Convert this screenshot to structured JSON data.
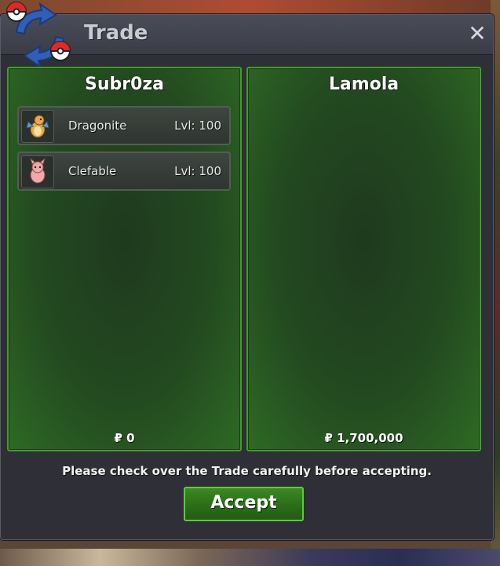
{
  "window": {
    "title": "Trade",
    "close_symbol": "✕"
  },
  "left_panel": {
    "player": "Subr0za",
    "money": "₽ 0",
    "pokemon": [
      {
        "name": "Dragonite",
        "level": "Lvl: 100",
        "icon": "dragonite-icon"
      },
      {
        "name": "Clefable",
        "level": "Lvl: 100",
        "icon": "clefable-icon"
      }
    ]
  },
  "right_panel": {
    "player": "Lamola",
    "money": "₽ 1,700,000",
    "pokemon": []
  },
  "footer": {
    "notice": "Please check over the Trade carefully before accepting.",
    "accept_label": "Accept"
  },
  "colors": {
    "panel_border": "#3fa026",
    "accept_green": "#2c6f18",
    "window_bg": "#2e2f37"
  }
}
